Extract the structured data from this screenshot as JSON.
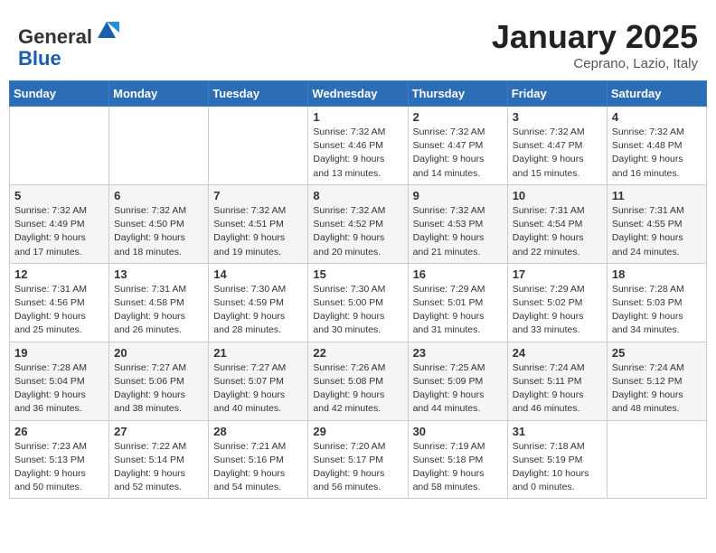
{
  "header": {
    "logo_line1": "General",
    "logo_line2": "Blue",
    "month": "January 2025",
    "location": "Ceprano, Lazio, Italy"
  },
  "weekdays": [
    "Sunday",
    "Monday",
    "Tuesday",
    "Wednesday",
    "Thursday",
    "Friday",
    "Saturday"
  ],
  "weeks": [
    [
      {
        "day": "",
        "info": ""
      },
      {
        "day": "",
        "info": ""
      },
      {
        "day": "",
        "info": ""
      },
      {
        "day": "1",
        "info": "Sunrise: 7:32 AM\nSunset: 4:46 PM\nDaylight: 9 hours\nand 13 minutes."
      },
      {
        "day": "2",
        "info": "Sunrise: 7:32 AM\nSunset: 4:47 PM\nDaylight: 9 hours\nand 14 minutes."
      },
      {
        "day": "3",
        "info": "Sunrise: 7:32 AM\nSunset: 4:47 PM\nDaylight: 9 hours\nand 15 minutes."
      },
      {
        "day": "4",
        "info": "Sunrise: 7:32 AM\nSunset: 4:48 PM\nDaylight: 9 hours\nand 16 minutes."
      }
    ],
    [
      {
        "day": "5",
        "info": "Sunrise: 7:32 AM\nSunset: 4:49 PM\nDaylight: 9 hours\nand 17 minutes."
      },
      {
        "day": "6",
        "info": "Sunrise: 7:32 AM\nSunset: 4:50 PM\nDaylight: 9 hours\nand 18 minutes."
      },
      {
        "day": "7",
        "info": "Sunrise: 7:32 AM\nSunset: 4:51 PM\nDaylight: 9 hours\nand 19 minutes."
      },
      {
        "day": "8",
        "info": "Sunrise: 7:32 AM\nSunset: 4:52 PM\nDaylight: 9 hours\nand 20 minutes."
      },
      {
        "day": "9",
        "info": "Sunrise: 7:32 AM\nSunset: 4:53 PM\nDaylight: 9 hours\nand 21 minutes."
      },
      {
        "day": "10",
        "info": "Sunrise: 7:31 AM\nSunset: 4:54 PM\nDaylight: 9 hours\nand 22 minutes."
      },
      {
        "day": "11",
        "info": "Sunrise: 7:31 AM\nSunset: 4:55 PM\nDaylight: 9 hours\nand 24 minutes."
      }
    ],
    [
      {
        "day": "12",
        "info": "Sunrise: 7:31 AM\nSunset: 4:56 PM\nDaylight: 9 hours\nand 25 minutes."
      },
      {
        "day": "13",
        "info": "Sunrise: 7:31 AM\nSunset: 4:58 PM\nDaylight: 9 hours\nand 26 minutes."
      },
      {
        "day": "14",
        "info": "Sunrise: 7:30 AM\nSunset: 4:59 PM\nDaylight: 9 hours\nand 28 minutes."
      },
      {
        "day": "15",
        "info": "Sunrise: 7:30 AM\nSunset: 5:00 PM\nDaylight: 9 hours\nand 30 minutes."
      },
      {
        "day": "16",
        "info": "Sunrise: 7:29 AM\nSunset: 5:01 PM\nDaylight: 9 hours\nand 31 minutes."
      },
      {
        "day": "17",
        "info": "Sunrise: 7:29 AM\nSunset: 5:02 PM\nDaylight: 9 hours\nand 33 minutes."
      },
      {
        "day": "18",
        "info": "Sunrise: 7:28 AM\nSunset: 5:03 PM\nDaylight: 9 hours\nand 34 minutes."
      }
    ],
    [
      {
        "day": "19",
        "info": "Sunrise: 7:28 AM\nSunset: 5:04 PM\nDaylight: 9 hours\nand 36 minutes."
      },
      {
        "day": "20",
        "info": "Sunrise: 7:27 AM\nSunset: 5:06 PM\nDaylight: 9 hours\nand 38 minutes."
      },
      {
        "day": "21",
        "info": "Sunrise: 7:27 AM\nSunset: 5:07 PM\nDaylight: 9 hours\nand 40 minutes."
      },
      {
        "day": "22",
        "info": "Sunrise: 7:26 AM\nSunset: 5:08 PM\nDaylight: 9 hours\nand 42 minutes."
      },
      {
        "day": "23",
        "info": "Sunrise: 7:25 AM\nSunset: 5:09 PM\nDaylight: 9 hours\nand 44 minutes."
      },
      {
        "day": "24",
        "info": "Sunrise: 7:24 AM\nSunset: 5:11 PM\nDaylight: 9 hours\nand 46 minutes."
      },
      {
        "day": "25",
        "info": "Sunrise: 7:24 AM\nSunset: 5:12 PM\nDaylight: 9 hours\nand 48 minutes."
      }
    ],
    [
      {
        "day": "26",
        "info": "Sunrise: 7:23 AM\nSunset: 5:13 PM\nDaylight: 9 hours\nand 50 minutes."
      },
      {
        "day": "27",
        "info": "Sunrise: 7:22 AM\nSunset: 5:14 PM\nDaylight: 9 hours\nand 52 minutes."
      },
      {
        "day": "28",
        "info": "Sunrise: 7:21 AM\nSunset: 5:16 PM\nDaylight: 9 hours\nand 54 minutes."
      },
      {
        "day": "29",
        "info": "Sunrise: 7:20 AM\nSunset: 5:17 PM\nDaylight: 9 hours\nand 56 minutes."
      },
      {
        "day": "30",
        "info": "Sunrise: 7:19 AM\nSunset: 5:18 PM\nDaylight: 9 hours\nand 58 minutes."
      },
      {
        "day": "31",
        "info": "Sunrise: 7:18 AM\nSunset: 5:19 PM\nDaylight: 10 hours\nand 0 minutes."
      },
      {
        "day": "",
        "info": ""
      }
    ]
  ]
}
